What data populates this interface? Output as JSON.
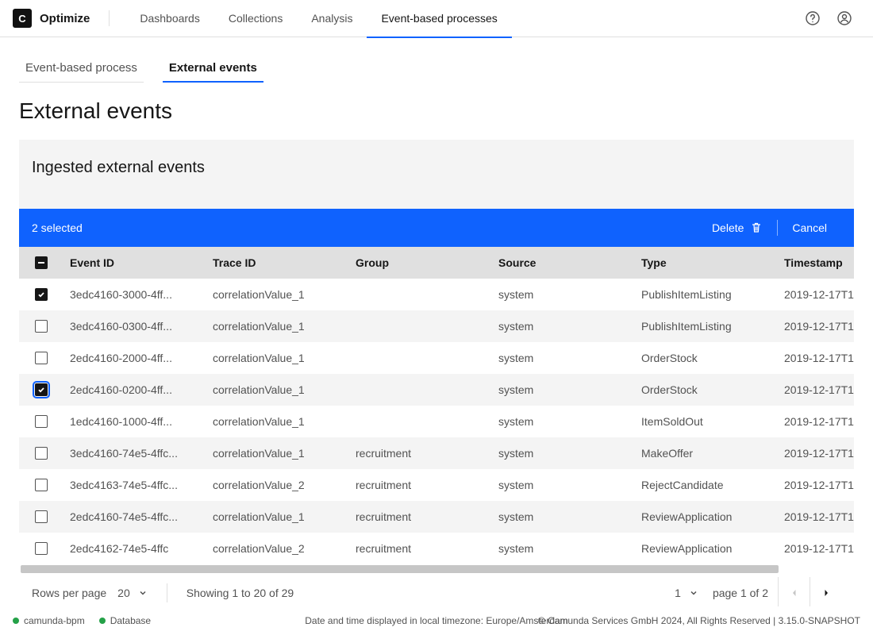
{
  "brand": "Optimize",
  "nav": {
    "items": [
      "Dashboards",
      "Collections",
      "Analysis",
      "Event-based processes"
    ],
    "active_index": 3
  },
  "subtabs": {
    "items": [
      "Event-based process",
      "External events"
    ],
    "active_index": 1
  },
  "page_title": "External events",
  "card_title": "Ingested external events",
  "selection": {
    "count_label": "2 selected",
    "delete_label": "Delete",
    "cancel_label": "Cancel"
  },
  "columns": [
    "Event ID",
    "Trace ID",
    "Group",
    "Source",
    "Type",
    "Timestamp"
  ],
  "rows": [
    {
      "checked": true,
      "focused": false,
      "event_id": "3edc4160-3000-4ff...",
      "trace_id": "correlationValue_1",
      "group": "",
      "source": "system",
      "type": "PublishItemListing",
      "ts": "2019-12-17T1"
    },
    {
      "checked": false,
      "focused": false,
      "event_id": "3edc4160-0300-4ff...",
      "trace_id": "correlationValue_1",
      "group": "",
      "source": "system",
      "type": "PublishItemListing",
      "ts": "2019-12-17T1"
    },
    {
      "checked": false,
      "focused": false,
      "event_id": "2edc4160-2000-4ff...",
      "trace_id": "correlationValue_1",
      "group": "",
      "source": "system",
      "type": "OrderStock",
      "ts": "2019-12-17T1"
    },
    {
      "checked": true,
      "focused": true,
      "event_id": "2edc4160-0200-4ff...",
      "trace_id": "correlationValue_1",
      "group": "",
      "source": "system",
      "type": "OrderStock",
      "ts": "2019-12-17T1"
    },
    {
      "checked": false,
      "focused": false,
      "event_id": "1edc4160-1000-4ff...",
      "trace_id": "correlationValue_1",
      "group": "",
      "source": "system",
      "type": "ItemSoldOut",
      "ts": "2019-12-17T1"
    },
    {
      "checked": false,
      "focused": false,
      "event_id": "3edc4160-74e5-4ffc...",
      "trace_id": "correlationValue_1",
      "group": "recruitment",
      "source": "system",
      "type": "MakeOffer",
      "ts": "2019-12-17T1"
    },
    {
      "checked": false,
      "focused": false,
      "event_id": "3edc4163-74e5-4ffc...",
      "trace_id": "correlationValue_2",
      "group": "recruitment",
      "source": "system",
      "type": "RejectCandidate",
      "ts": "2019-12-17T1"
    },
    {
      "checked": false,
      "focused": false,
      "event_id": "2edc4160-74e5-4ffc...",
      "trace_id": "correlationValue_1",
      "group": "recruitment",
      "source": "system",
      "type": "ReviewApplication",
      "ts": "2019-12-17T1"
    },
    {
      "checked": false,
      "focused": false,
      "event_id": "2edc4162-74e5-4ffc",
      "trace_id": "correlationValue_2",
      "group": "recruitment",
      "source": "system",
      "type": "ReviewApplication",
      "ts": "2019-12-17T1"
    }
  ],
  "pagination": {
    "rows_per_page_label": "Rows per page",
    "rows_per_page_value": "20",
    "showing": "Showing 1 to 20 of 29",
    "page_number": "1",
    "page_of": "page 1 of 2"
  },
  "footer": {
    "status": [
      {
        "label": "camunda-bpm"
      },
      {
        "label": "Database"
      }
    ],
    "tz": "Date and time displayed in local timezone: Europe/Amsterdam",
    "copyright": "© Camunda Services GmbH 2024, All Rights Reserved | 3.15.0-SNAPSHOT"
  }
}
